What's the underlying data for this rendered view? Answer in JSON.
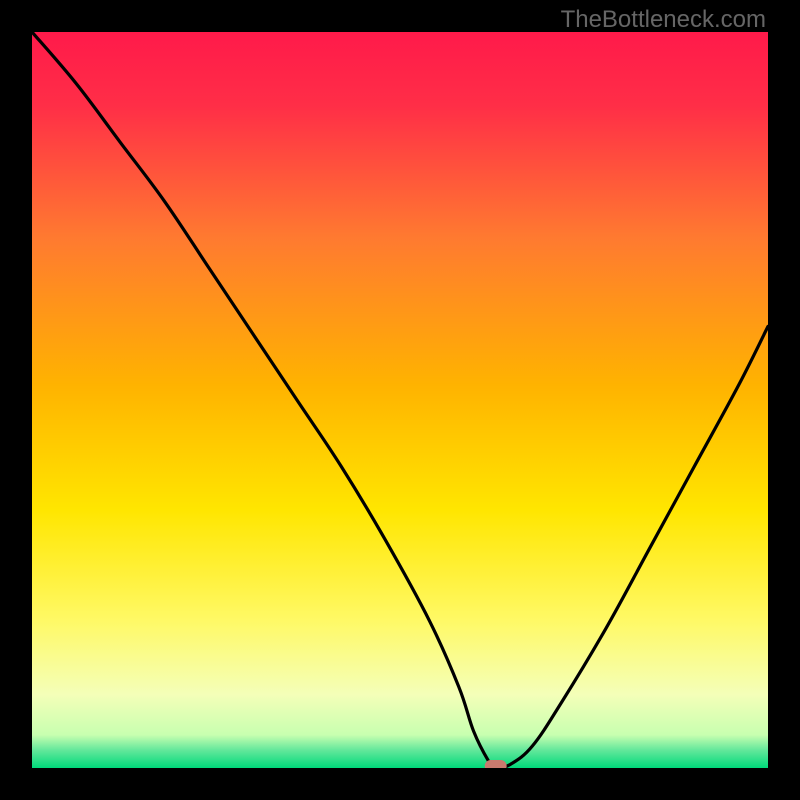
{
  "watermark": "TheBottleneck.com",
  "colors": {
    "frame": "#000000",
    "gradient_top": "#ff1a4a",
    "gradient_upper_mid": "#ff8c2a",
    "gradient_mid": "#ffd700",
    "gradient_lower_mid": "#ffff66",
    "gradient_pale": "#f5ffcc",
    "gradient_bottom": "#00d97a",
    "curve": "#000000",
    "marker": "#c97a6e"
  },
  "chart_data": {
    "type": "line",
    "title": "",
    "xlabel": "",
    "ylabel": "",
    "xlim": [
      0,
      100
    ],
    "ylim": [
      0,
      100
    ],
    "series": [
      {
        "name": "bottleneck-curve",
        "x": [
          0,
          6,
          12,
          18,
          24,
          30,
          36,
          42,
          48,
          54,
          58,
          60,
          62,
          63,
          65,
          68,
          72,
          78,
          84,
          90,
          96,
          100
        ],
        "y": [
          100,
          93,
          85,
          77,
          68,
          59,
          50,
          41,
          31,
          20,
          11,
          5,
          1,
          0,
          0.5,
          3,
          9,
          19,
          30,
          41,
          52,
          60
        ]
      }
    ],
    "minimum_marker": {
      "x": 63,
      "y": 0
    },
    "annotations": []
  }
}
